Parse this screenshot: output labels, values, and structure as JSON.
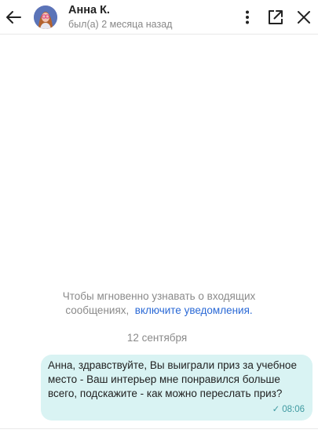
{
  "header": {
    "contact_name": "Анна К.",
    "last_seen": "был(а) 2 месяца назад"
  },
  "notification_prompt": {
    "line1": "Чтобы мгновенно узнавать о входящих",
    "line2_prefix": "сообщениях,",
    "link_label": "включите уведомления."
  },
  "date_separator": "12 сентября",
  "messages": [
    {
      "text": "Анна, здравствуйте, Вы выиграли приз за учебное место - Ваш интерьер мне понравился больше всего, подскажите - как можно переслать приз?",
      "time": "08:06",
      "status_icon": "check-icon"
    }
  ],
  "icons": {
    "back": "arrow-left-icon",
    "menu": "more-vertical-icon",
    "open_external": "external-link-icon",
    "close": "close-icon"
  },
  "colors": {
    "bubble_bg": "#d9f3f3",
    "link": "#2a69d6",
    "meta": "#3f9aa1",
    "muted": "#8a8a8a"
  }
}
